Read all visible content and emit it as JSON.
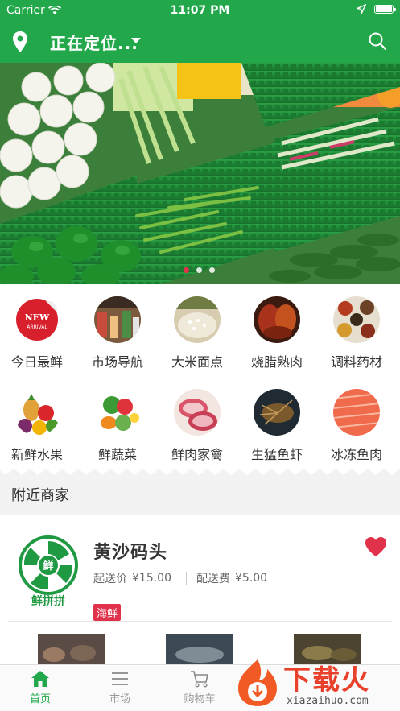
{
  "status_bar": {
    "carrier": "Carrier",
    "time": "11:07 PM"
  },
  "header": {
    "location_text": "正在定位...",
    "icons": [
      "location-pin-icon",
      "dropdown-caret-icon",
      "search-icon"
    ]
  },
  "banner": {
    "slide_count": 3,
    "active_index": 0
  },
  "categories": [
    {
      "label": "今日最鲜",
      "icon": "new-arrival-icon"
    },
    {
      "label": "市场导航",
      "icon": "market-icon"
    },
    {
      "label": "大米面点",
      "icon": "rice-icon"
    },
    {
      "label": "烧腊熟肉",
      "icon": "roast-meat-icon"
    },
    {
      "label": "调料药材",
      "icon": "spices-icon"
    },
    {
      "label": "新鲜水果",
      "icon": "fruit-icon"
    },
    {
      "label": "鲜蔬菜",
      "icon": "vegetables-icon"
    },
    {
      "label": "鲜肉家禽",
      "icon": "meat-icon"
    },
    {
      "label": "生猛鱼虾",
      "icon": "seafood-icon"
    },
    {
      "label": "冰冻鱼肉",
      "icon": "frozen-fish-icon"
    }
  ],
  "nearby": {
    "title": "附近商家",
    "shop": {
      "name": "黄沙码头",
      "min_order_label": "起送价",
      "min_order_value": "¥15.00",
      "delivery_fee_label": "配送费",
      "delivery_fee_value": "¥5.00",
      "tag": "海鲜",
      "logo_text": "鲜拼拼",
      "logo_center": "鲜",
      "favorited": true
    }
  },
  "tabbar": {
    "items": [
      {
        "label": "首页",
        "icon": "home-icon",
        "active": true
      },
      {
        "label": "市场",
        "icon": "list-icon",
        "active": false
      },
      {
        "label": "购物车",
        "icon": "cart-icon",
        "active": false
      }
    ]
  },
  "watermark": {
    "text": "下载火",
    "url": "xiazaihuo.com"
  },
  "colors": {
    "primary": "#22a84a",
    "accent": "#e0324b",
    "background": "#f2f2f2"
  }
}
